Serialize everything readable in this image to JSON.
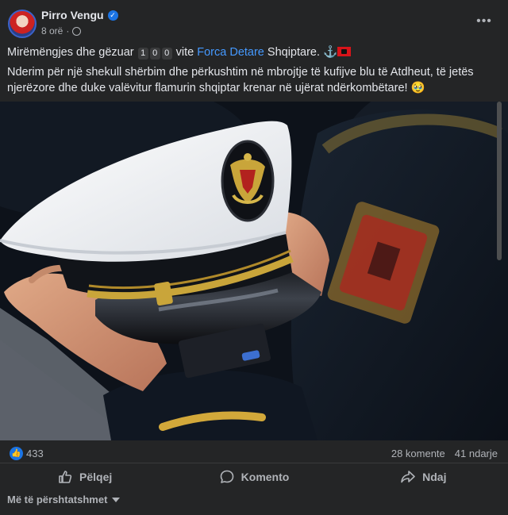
{
  "post": {
    "author": "Pirro Vengu",
    "timestamp": "8 orë",
    "visibility_icon": "globe-icon",
    "text": {
      "greeting_prefix": "Mirëmëngjes dhe gëzuar ",
      "digits": [
        "1",
        "0",
        "0"
      ],
      "middle": " vite ",
      "link": "Forca Detare",
      "suffix": " Shqiptare. ",
      "emoji": "⚓",
      "paragraph2_line1": "Nderim për një shekull shërbim dhe përkushtim në mbrojtje të kufijve blu të Atdheut, të jetës",
      "paragraph2_line2": "njerëzore dhe duke valëvitur flamurin shqiptar krenar në ujërat ndërkombëtare! 🥹"
    }
  },
  "reactions": {
    "like_count": "433",
    "comments": "28 komente",
    "shares": "41 ndarje"
  },
  "actions": {
    "like": "Pëlqej",
    "comment": "Komento",
    "share": "Ndaj"
  },
  "filter": {
    "label": "Më të përshtatshmet"
  },
  "colors": {
    "background": "#242526",
    "link": "#4599ff",
    "accent": "#1b74e4",
    "secondary_text": "#b0b3b8"
  }
}
